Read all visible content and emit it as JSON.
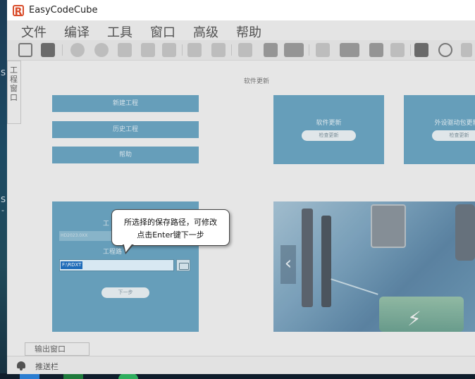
{
  "window": {
    "title": "EasyCodeCube"
  },
  "menu": {
    "items": [
      "文件",
      "编译",
      "工具",
      "窗口",
      "高级",
      "帮助"
    ]
  },
  "toolbar": {
    "icons": [
      "new-file-icon",
      "open-folder-icon",
      "refresh-icon",
      "forward-icon",
      "chip-icon",
      "download-icon",
      "save-icon",
      "back-icon",
      "delete-icon",
      "book-icon",
      "monitor-icon",
      "list-dropdown-icon",
      "stop-icon",
      "note-dropdown-icon",
      "search-doc-icon",
      "folder-icon",
      "chat-icon",
      "globe-icon",
      "menu-icon"
    ]
  },
  "side_tab": {
    "label": "工程窗口"
  },
  "welcome": {
    "section_title": "软件更新",
    "buttons": {
      "new_project": "新建工程",
      "history_project": "历史工程",
      "help": "帮助"
    },
    "cards": [
      {
        "title": "软件更新",
        "button": "检查更新"
      },
      {
        "title": "外设驱动包更新",
        "button": "检查更新"
      }
    ],
    "project": {
      "name_label": "工",
      "name_value": "HD2023.0XX",
      "path_label": "工程路",
      "path_value": "F:\\RDXT",
      "next_button": "下一步"
    }
  },
  "tooltip": {
    "line1": "所选择的保存路径，可修改",
    "line2": "点击Enter键下一步"
  },
  "bottom": {
    "output_tab": "输出窗口",
    "status_label": "推送栏"
  },
  "desktop": {
    "glyph1": "S",
    "glyph2": "S",
    "glyph3": "-"
  },
  "colors": {
    "accent_blue": "#6aa4c0",
    "selection": "#1e6fbf",
    "logo": "#d94d2b"
  }
}
